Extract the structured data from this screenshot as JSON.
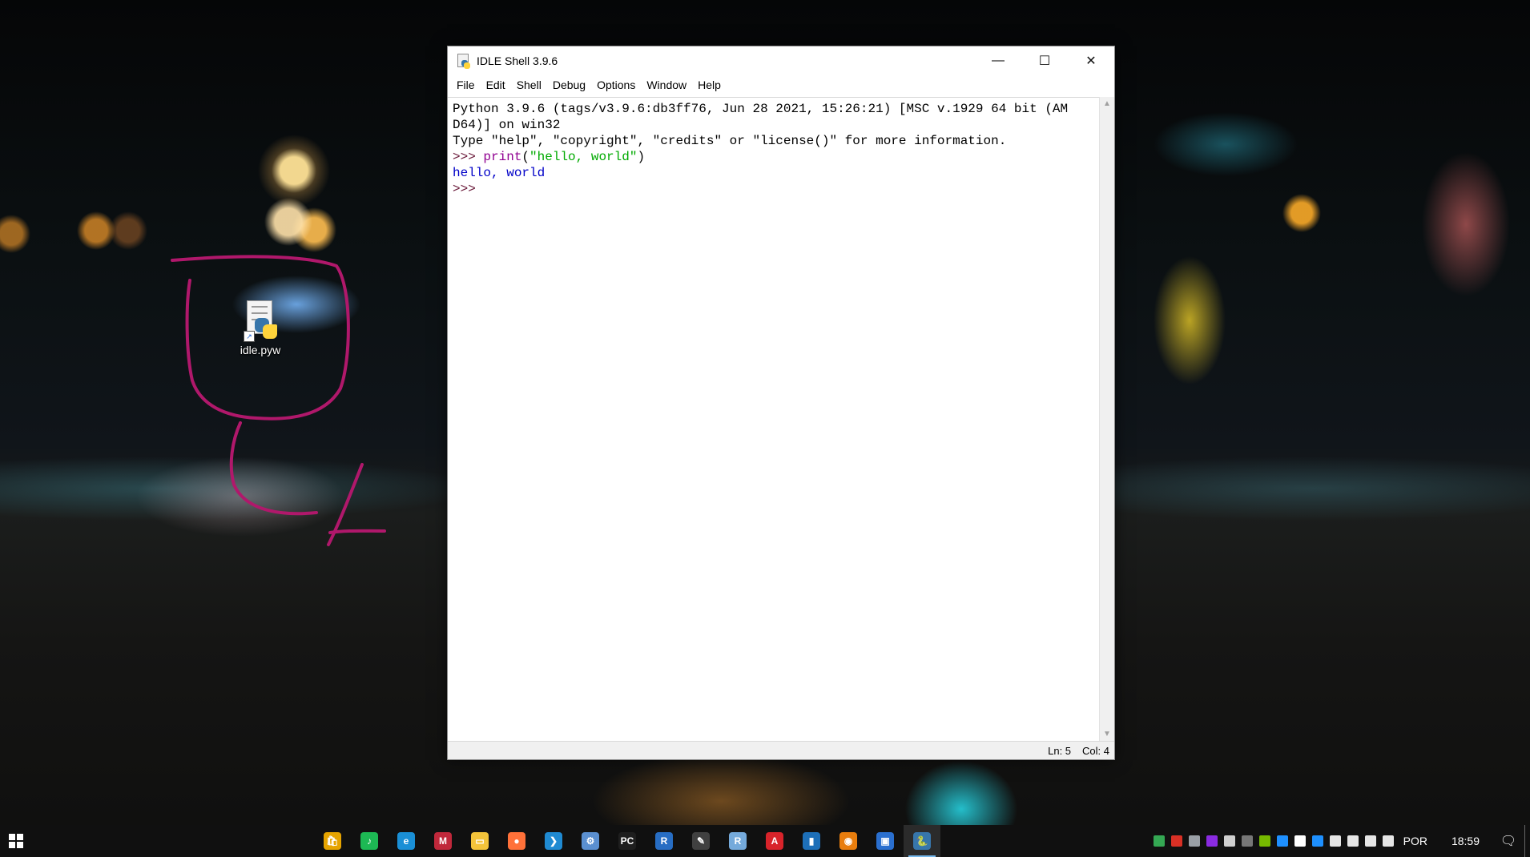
{
  "desktop": {
    "icon_label": "idle.pyw",
    "annotations": [
      "1",
      "2"
    ]
  },
  "window": {
    "title": "IDLE Shell 3.9.6",
    "controls": {
      "minimize": "—",
      "maximize": "☐",
      "close": "✕"
    },
    "menu": [
      "File",
      "Edit",
      "Shell",
      "Debug",
      "Options",
      "Window",
      "Help"
    ],
    "shell": {
      "banner_line1": "Python 3.9.6 (tags/v3.9.6:db3ff76, Jun 28 2021, 15:26:21) [MSC v.1929 64 bit (AM",
      "banner_line2": "D64)] on win32",
      "banner_line3": "Type \"help\", \"copyright\", \"credits\" or \"license()\" for more information.",
      "prompt": ">>> ",
      "cmd_builtin": "print",
      "cmd_open": "(",
      "cmd_string": "\"hello, world\"",
      "cmd_close": ")",
      "output": "hello, world",
      "prompt2": ">>>"
    },
    "status": {
      "line": "Ln: 5",
      "col": "Col: 4"
    }
  },
  "taskbar": {
    "apps": [
      {
        "name": "store-app",
        "color": "#e6a400",
        "glyph": "🛍"
      },
      {
        "name": "spotify-app",
        "color": "#1db954",
        "glyph": "♪"
      },
      {
        "name": "edge-app",
        "color": "#1a8fd6",
        "glyph": "e"
      },
      {
        "name": "mendeley-app",
        "color": "#c0283b",
        "glyph": "M"
      },
      {
        "name": "file-explorer-app",
        "color": "#f3c33a",
        "glyph": "▭"
      },
      {
        "name": "firefox-app",
        "color": "#ff7139",
        "glyph": "●"
      },
      {
        "name": "vscode-app",
        "color": "#1f8ad2",
        "glyph": "❯"
      },
      {
        "name": "settings-app",
        "color": "#5a8fd0",
        "glyph": "⚙"
      },
      {
        "name": "pycharm-app",
        "color": "#1e1e1e",
        "glyph": "PC"
      },
      {
        "name": "r-app",
        "color": "#276dc3",
        "glyph": "R"
      },
      {
        "name": "tool-app",
        "color": "#404040",
        "glyph": "✎"
      },
      {
        "name": "rstudio-app",
        "color": "#75aadb",
        "glyph": "R"
      },
      {
        "name": "acrobat-app",
        "color": "#d8232a",
        "glyph": "A"
      },
      {
        "name": "app-blue",
        "color": "#1d6fb8",
        "glyph": "▮"
      },
      {
        "name": "blender-app",
        "color": "#e87d0d",
        "glyph": "◉"
      },
      {
        "name": "photos-app",
        "color": "#2a6fcf",
        "glyph": "▣"
      },
      {
        "name": "idle-app",
        "color": "#3776ab",
        "glyph": "🐍",
        "active": true
      }
    ],
    "tray_colors": [
      "#34a853",
      "#d93025",
      "#9aa0a6",
      "#8a2be2",
      "#cfcfcf",
      "#777777",
      "#76b900",
      "#1e90ff",
      "#ffffff",
      "#1e90ff",
      "#e6e6e6",
      "#e6e6e6",
      "#e6e6e6",
      "#e6e6e6"
    ],
    "language": "POR",
    "time": "18:59"
  }
}
